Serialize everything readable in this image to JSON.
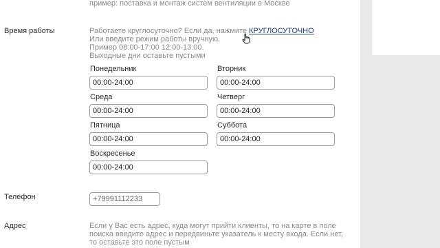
{
  "top_hint": "пример: поставка и монтаж систем вентиляции в Москве",
  "hours": {
    "label": "Время работы",
    "hint_prefix": "Работаете круглосуточно? Если да, нажмите",
    "round_the_clock_link": "КРУГЛОСУТОЧНО",
    "hint_line2": "Или введите режим работы вручную.",
    "hint_line3": "Пример 08:00-17:00 12:00-13:00.",
    "hint_line4": "Выходные дни оставьте пустыми",
    "days": [
      {
        "name": "Понедельник",
        "value": "00:00-24:00"
      },
      {
        "name": "Вторник",
        "value": "00:00-24:00"
      },
      {
        "name": "Среда",
        "value": "00:00-24:00"
      },
      {
        "name": "Четверг",
        "value": "00:00-24:00"
      },
      {
        "name": "Пятница",
        "value": "00:00-24:00"
      },
      {
        "name": "Суббота",
        "value": "00:00-24:00"
      },
      {
        "name": "Воскресенье",
        "value": "00:00-24:00"
      }
    ]
  },
  "phone": {
    "label": "Телефон",
    "value": "+79991112233"
  },
  "address": {
    "label": "Адрес",
    "hint_line1": "Если у Вас есть адрес, куда могут прийти клиенты, то на карте в поле",
    "hint_line2": "поиска введите адрес и передвиньте указатель к месту входа. Если нет,",
    "hint_line3": "то оставьте это поле пустым"
  },
  "colors": {
    "link": "#1d3c8c",
    "hint_text": "#8a8a8a",
    "field_border": "#9a9a9a",
    "background": "#e9e9e9"
  },
  "icons": {
    "cursor": "hand-pointer-icon"
  }
}
